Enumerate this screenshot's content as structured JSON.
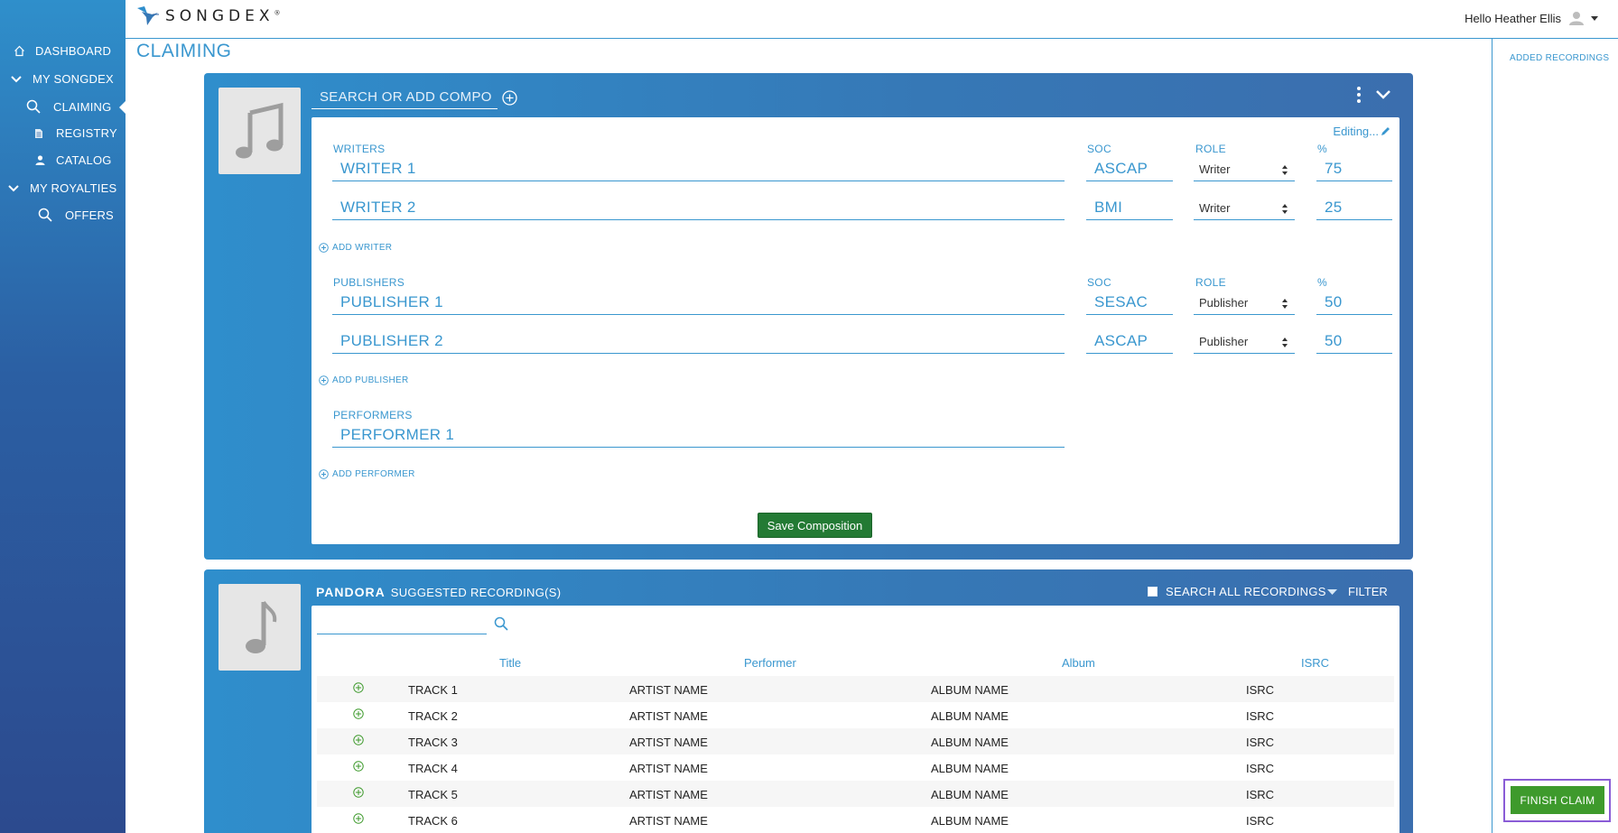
{
  "brand": {
    "name": "SONGDEX",
    "reg": "®"
  },
  "user": {
    "greeting": "Hello Heather Ellis"
  },
  "sidebar": {
    "items": [
      {
        "label": "DASHBOARD",
        "icon": "home-icon"
      },
      {
        "label": "MY SONGDEX",
        "icon": "chevron-down-icon"
      },
      {
        "label": "CLAIMING",
        "icon": "search-icon",
        "active": true
      },
      {
        "label": "REGISTRY",
        "icon": "document-icon"
      },
      {
        "label": "CATALOG",
        "icon": "person-icon"
      },
      {
        "label": "MY ROYALTIES",
        "icon": "chevron-down-icon"
      },
      {
        "label": "OFFERS",
        "icon": "search-icon"
      }
    ]
  },
  "page": {
    "title": "CLAIMING"
  },
  "right_panel": {
    "title": "ADDED RECORDINGS",
    "finish_label": "FINISH CLAIM"
  },
  "composition": {
    "search_placeholder": "SEARCH OR ADD COMPO",
    "editing_label": "Editing...",
    "writers": {
      "label": "WRITERS",
      "soc_label": "SOC",
      "role_label": "ROLE",
      "pct_label": "%",
      "rows": [
        {
          "name": "WRITER 1",
          "soc": "ASCAP",
          "role": "Writer",
          "pct": "75"
        },
        {
          "name": "WRITER 2",
          "soc": "BMI",
          "role": "Writer",
          "pct": "25"
        }
      ],
      "add_label": "ADD WRITER"
    },
    "publishers": {
      "label": "PUBLISHERS",
      "soc_label": "SOC",
      "role_label": "ROLE",
      "pct_label": "%",
      "rows": [
        {
          "name": "PUBLISHER 1",
          "soc": "SESAC",
          "role": "Publisher",
          "pct": "50"
        },
        {
          "name": "PUBLISHER 2",
          "soc": "ASCAP",
          "role": "Publisher",
          "pct": "50"
        }
      ],
      "add_label": "ADD PUBLISHER"
    },
    "performers": {
      "label": "PERFORMERS",
      "rows": [
        {
          "name": "PERFORMER 1"
        }
      ],
      "add_label": "ADD PERFORMER"
    },
    "save_label": "Save Composition"
  },
  "recordings": {
    "source": "PANDORA",
    "heading": "SUGGESTED RECORDING(S)",
    "search_all_label": "SEARCH ALL RECORDINGS",
    "filter_label": "FILTER",
    "columns": [
      "Title",
      "Performer",
      "Album",
      "ISRC"
    ],
    "rows": [
      {
        "title": "TRACK 1",
        "performer": "ARTIST NAME",
        "album": "ALBUM NAME",
        "isrc": "ISRC"
      },
      {
        "title": "TRACK 2",
        "performer": "ARTIST NAME",
        "album": "ALBUM NAME",
        "isrc": "ISRC"
      },
      {
        "title": "TRACK 3",
        "performer": "ARTIST NAME",
        "album": "ALBUM NAME",
        "isrc": "ISRC"
      },
      {
        "title": "TRACK 4",
        "performer": "ARTIST NAME",
        "album": "ALBUM NAME",
        "isrc": "ISRC"
      },
      {
        "title": "TRACK 5",
        "performer": "ARTIST NAME",
        "album": "ALBUM NAME",
        "isrc": "ISRC"
      },
      {
        "title": "TRACK 6",
        "performer": "ARTIST NAME",
        "album": "ALBUM NAME",
        "isrc": "ISRC"
      }
    ]
  },
  "colors": {
    "accent": "#3a97cf",
    "save_green": "#237a34",
    "finish_green": "#3e9a2c",
    "highlight": "#8a5cd6"
  }
}
